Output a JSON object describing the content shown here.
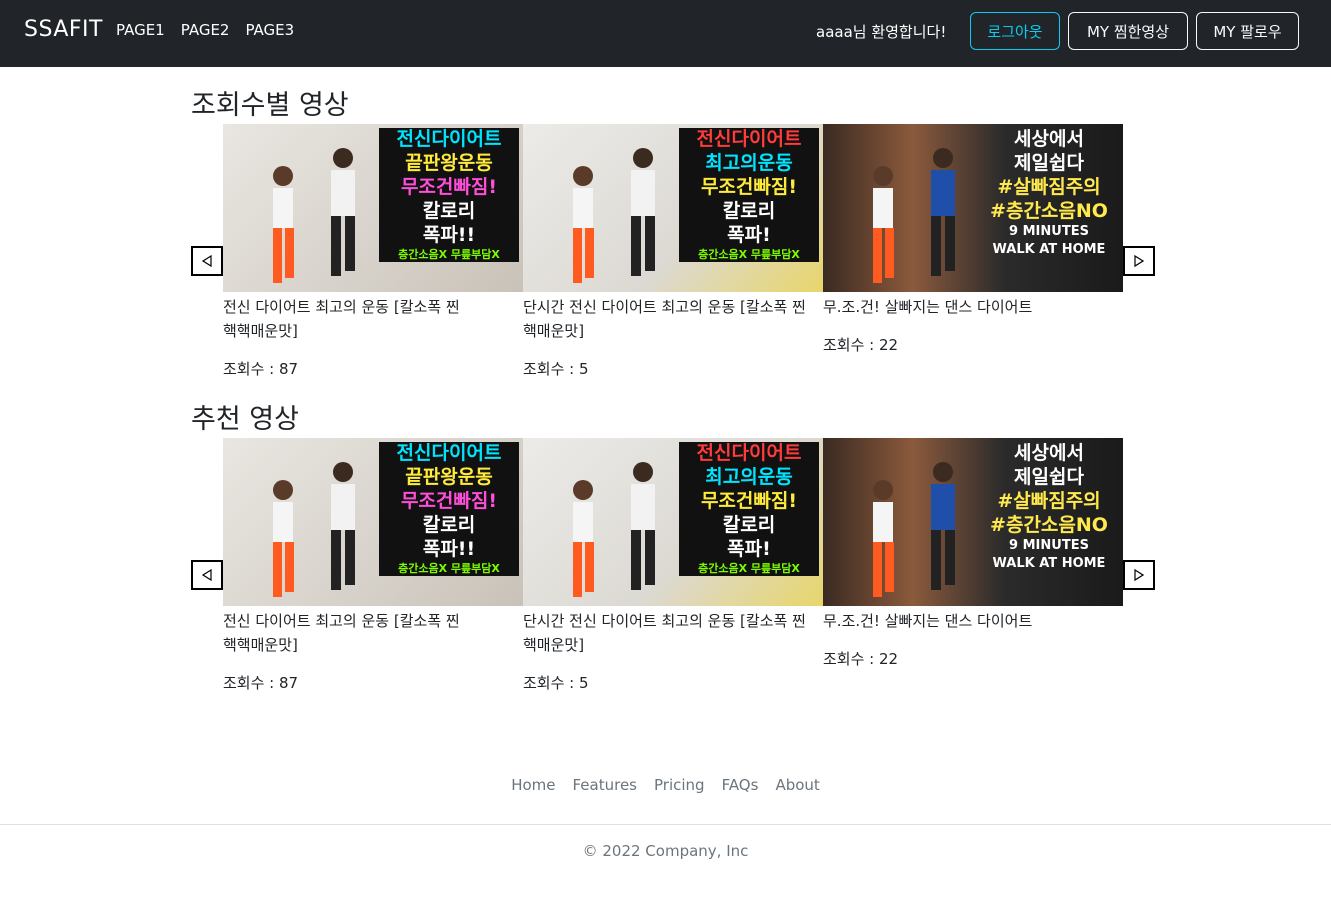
{
  "navbar": {
    "brand": "SSAFIT",
    "links": [
      "PAGE1",
      "PAGE2",
      "PAGE3"
    ],
    "welcome": "aaaa님 환영합니다!",
    "logout_label": "로그아웃",
    "liked_label": "MY 찜한영상",
    "follow_label": "MY 팔로우"
  },
  "sections": [
    {
      "title": "조회수별 영상",
      "videos": [
        {
          "title": "전신 다이어트 최고의 운동 [칼소폭 찐 핵핵매운맛]",
          "views": "조회수 : 87",
          "thumb_lines": [
            "전신다이어트",
            "끝판왕운동",
            "무조건빠짐!",
            "칼로리",
            "폭파!!",
            "층간소음X 무릎부담X"
          ]
        },
        {
          "title": "단시간 전신 다이어트 최고의 운동 [칼소폭 찐 핵매운맛]",
          "views": "조회수 : 5",
          "thumb_lines": [
            "전신다이어트",
            "최고의운동",
            "무조건빠짐!",
            "칼로리",
            "폭파!",
            "층간소음X 무릎부담X"
          ]
        },
        {
          "title": "무.조.건! 살빠지는 댄스 다이어트",
          "views": "조회수 : 22",
          "thumb_lines": [
            "세상에서",
            "제일쉽다",
            "#살빠짐주의",
            "#층간소음NO",
            "9 MINUTES",
            "WALK AT HOME"
          ]
        }
      ]
    },
    {
      "title": "추천 영상",
      "videos": [
        {
          "title": "전신 다이어트 최고의 운동 [칼소폭 찐 핵핵매운맛]",
          "views": "조회수 : 87",
          "thumb_lines": [
            "전신다이어트",
            "끝판왕운동",
            "무조건빠짐!",
            "칼로리",
            "폭파!!",
            "층간소음X 무릎부담X"
          ]
        },
        {
          "title": "단시간 전신 다이어트 최고의 운동 [칼소폭 찐 핵매운맛]",
          "views": "조회수 : 5",
          "thumb_lines": [
            "전신다이어트",
            "최고의운동",
            "무조건빠짐!",
            "칼로리",
            "폭파!",
            "층간소음X 무릎부담X"
          ]
        },
        {
          "title": "무.조.건! 살빠지는 댄스 다이어트",
          "views": "조회수 : 22",
          "thumb_lines": [
            "세상에서",
            "제일쉽다",
            "#살빠짐주의",
            "#층간소음NO",
            "9 MINUTES",
            "WALK AT HOME"
          ]
        }
      ]
    }
  ],
  "carousel": {
    "prev_icon": "triangle-left-icon",
    "next_icon": "triangle-right-icon"
  },
  "footer": {
    "links": [
      "Home",
      "Features",
      "Pricing",
      "FAQs",
      "About"
    ],
    "copyright": "© 2022 Company, Inc"
  },
  "colors": {
    "navbar_bg": "#212529",
    "logout_accent": "#0dcaf0",
    "footer_text": "#6c757d"
  }
}
